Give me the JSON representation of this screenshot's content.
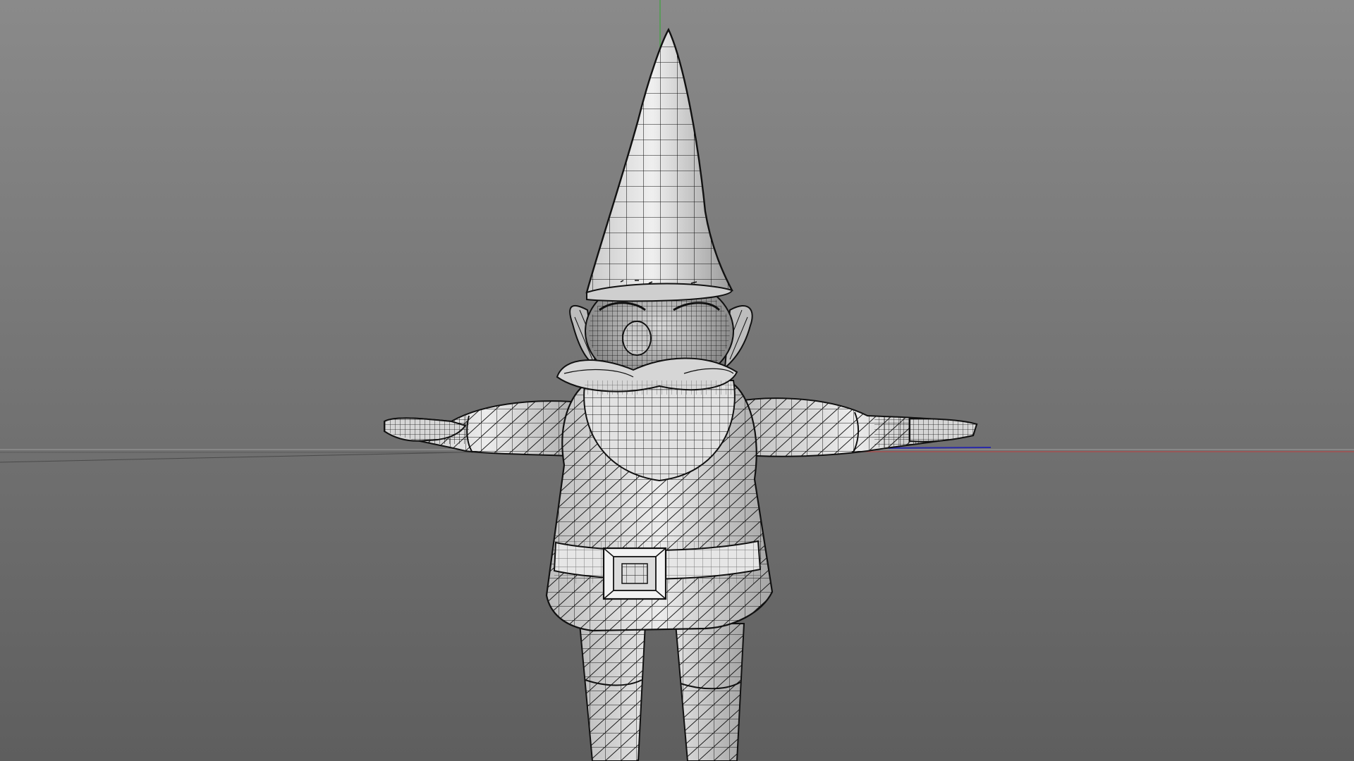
{
  "viewport": {
    "background_top": "#8a8a8a",
    "background_bottom": "#5e5e5e",
    "mesh_fill": "#dcdcdc",
    "mesh_shade": "#a8a8a8",
    "wire_color": "#111111",
    "grid_line_color": "#9e9e9e",
    "axis_x_color": "#b04a4a",
    "axis_y_color": "#3fa33f",
    "axis_z_color": "#2a2aa8",
    "model": "gnome",
    "display_mode": "wireframe-on-shaded"
  }
}
